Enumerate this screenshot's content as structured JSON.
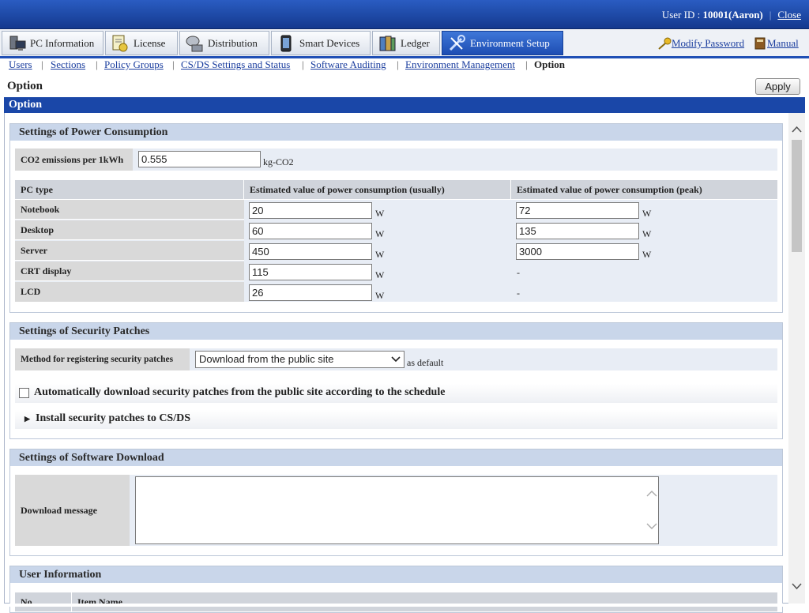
{
  "header": {
    "user_label": "User ID : ",
    "user_value": "10001(Aaron)",
    "close_label": "Close"
  },
  "tabs": [
    {
      "label": "PC Information",
      "icon": "pc-icon"
    },
    {
      "label": "License",
      "icon": "license-icon"
    },
    {
      "label": "Distribution",
      "icon": "distribution-icon"
    },
    {
      "label": "Smart Devices",
      "icon": "smartphone-icon"
    },
    {
      "label": "Ledger",
      "icon": "ledger-icon"
    },
    {
      "label": "Environment Setup",
      "icon": "tools-icon",
      "active": true
    }
  ],
  "top_links": {
    "modify_password": "Modify Password",
    "manual": "Manual"
  },
  "subnav": {
    "users": "Users",
    "sections": "Sections",
    "policy_groups": "Policy Groups",
    "csds": "CS/DS Settings and Status",
    "software_auditing": "Software Auditing",
    "env_management": "Environment Management",
    "option": "Option"
  },
  "page": {
    "title": "Option",
    "apply_label": "Apply",
    "section_title": "Option"
  },
  "power": {
    "title": "Settings of Power Consumption",
    "co2_label": "CO2 emissions per 1kWh",
    "co2_value": "0.555",
    "co2_unit": "kg-CO2",
    "headers": [
      "PC type",
      "Estimated value of power consumption (usually)",
      "Estimated value of power consumption (peak)"
    ],
    "unit": "W",
    "rows": [
      {
        "type": "Notebook",
        "usual": "20",
        "peak": "72"
      },
      {
        "type": "Desktop",
        "usual": "60",
        "peak": "135"
      },
      {
        "type": "Server",
        "usual": "450",
        "peak": "3000"
      },
      {
        "type": "CRT display",
        "usual": "115",
        "peak": "-"
      },
      {
        "type": "LCD",
        "usual": "26",
        "peak": "-"
      }
    ]
  },
  "security": {
    "title": "Settings of Security Patches",
    "method_label": "Method for registering security patches",
    "method_value": "Download from the public site",
    "method_suffix": "as default",
    "auto_download_label": "Automatically download security patches from the public site according to the schedule",
    "install_label": "Install security patches to CS/DS"
  },
  "software": {
    "title": "Settings of Software Download",
    "message_label": "Download message",
    "message_value": ""
  },
  "user_info": {
    "title": "User Information",
    "col_no": "No.",
    "col_item": "Item Name"
  },
  "colors": {
    "header_blue": "#1a47a8",
    "panel_header": "#c9d6ea",
    "label_gray": "#d9d9d9"
  }
}
